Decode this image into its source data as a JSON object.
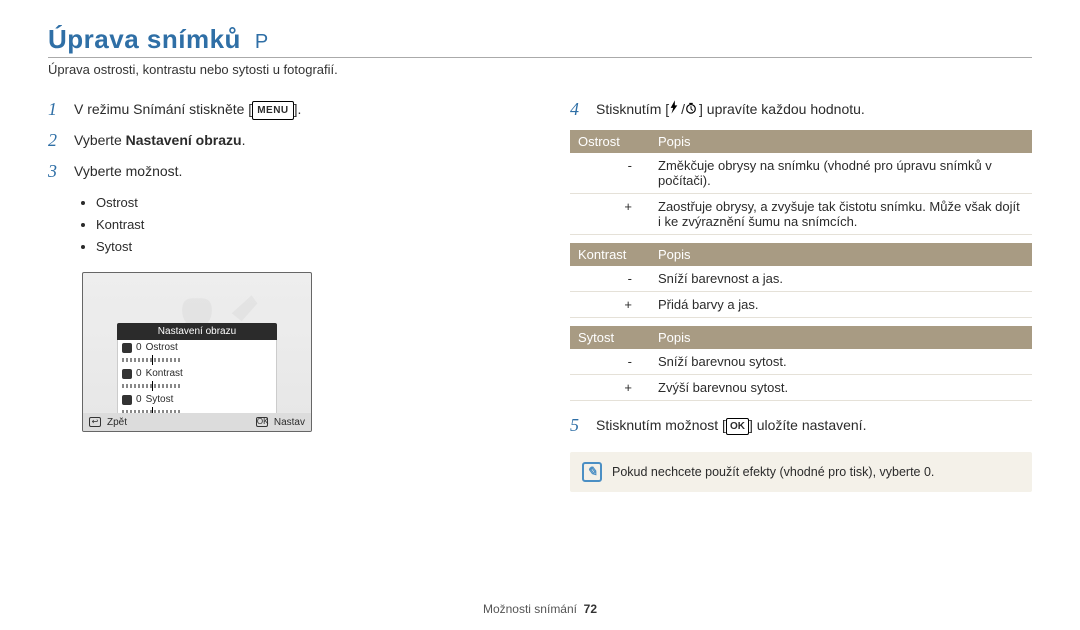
{
  "header": {
    "title": "Úprava snímků",
    "mode": "P",
    "subtitle": "Úprava ostrosti, kontrastu nebo sytosti u fotografií."
  },
  "steps": {
    "1": {
      "pre": "V režimu Snímání stiskněte [",
      "menu": "MENU",
      "post": "]."
    },
    "2": {
      "pre": "Vyberte ",
      "bold": "Nastavení obrazu",
      "post": "."
    },
    "3": {
      "text": "Vyberte možnost."
    },
    "4": {
      "pre": "Stisknutím [",
      "mid": "/",
      "post": "] upravíte každou hodnotu."
    },
    "5": {
      "pre": "Stisknutím možnost [",
      "ok": "OK",
      "post": "] uložíte nastavení."
    }
  },
  "bullets": [
    "Ostrost",
    "Kontrast",
    "Sytost"
  ],
  "camera": {
    "overlay_title": "Nastavení obrazu",
    "rows": [
      {
        "value": "0",
        "label": "Ostrost"
      },
      {
        "value": "0",
        "label": "Kontrast"
      },
      {
        "value": "0",
        "label": "Sytost"
      }
    ],
    "back": "Zpět",
    "ok": "OK",
    "set": "Nastav"
  },
  "tables": {
    "ostrost": {
      "h1": "Ostrost",
      "h2": "Popis",
      "rows": [
        {
          "sign": "-",
          "desc": "Změkčuje obrysy na snímku (vhodné pro úpravu snímků v počítači)."
        },
        {
          "sign": "+",
          "desc": "Zaostřuje obrysy, a zvyšuje tak čistotu snímku. Může však dojít i ke zvýraznění šumu na snímcích."
        }
      ]
    },
    "kontrast": {
      "h1": "Kontrast",
      "h2": "Popis",
      "rows": [
        {
          "sign": "-",
          "desc": "Sníží barevnost a jas."
        },
        {
          "sign": "+",
          "desc": "Přidá barvy a jas."
        }
      ]
    },
    "sytost": {
      "h1": "Sytost",
      "h2": "Popis",
      "rows": [
        {
          "sign": "-",
          "desc": "Sníží barevnou sytost."
        },
        {
          "sign": "+",
          "desc": "Zvýší barevnou sytost."
        }
      ]
    }
  },
  "note": "Pokud nechcete použít efekty (vhodné pro tisk), vyberte 0.",
  "footer": {
    "section": "Možnosti snímání",
    "page": "72"
  }
}
